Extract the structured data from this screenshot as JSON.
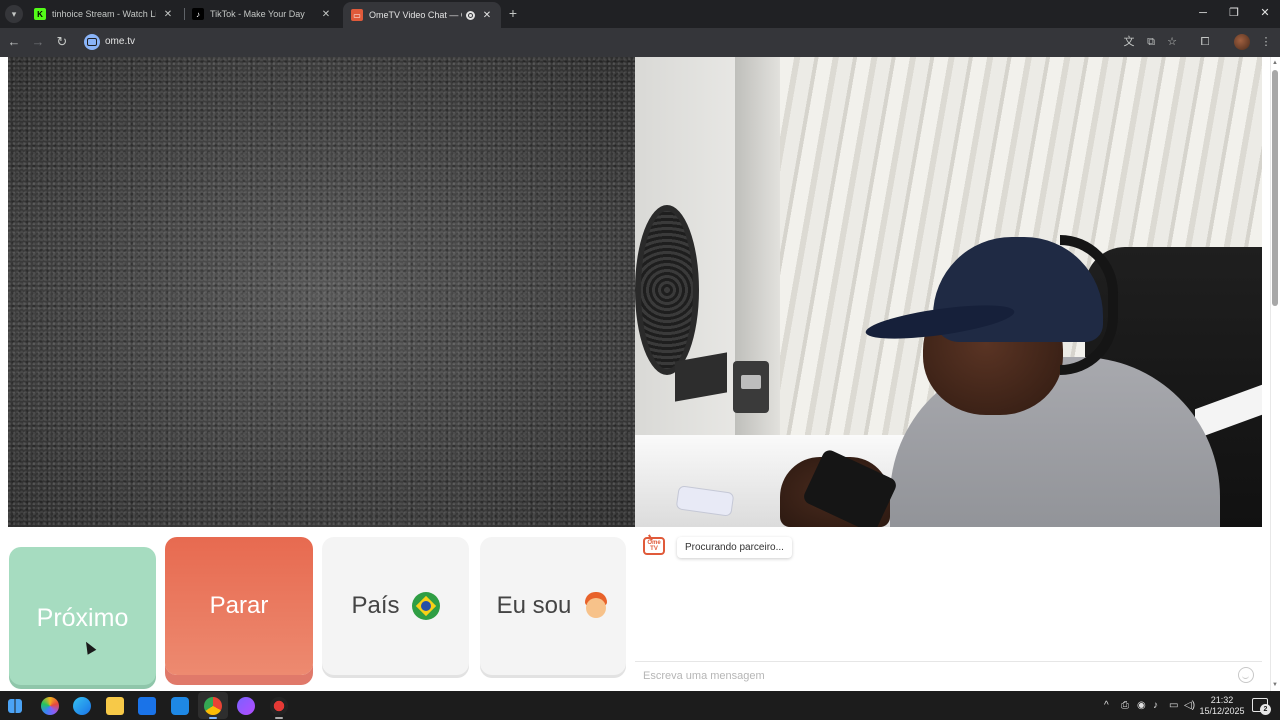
{
  "browser": {
    "tabs": [
      {
        "title": "tinhoice Stream - Watch Live or",
        "favicon": "kick-icon",
        "active": false
      },
      {
        "title": "TikTok - Make Your Day",
        "favicon": "tiktok-icon",
        "active": false
      },
      {
        "title": "OmeTV Video Chat — Ome",
        "favicon": "ometv-icon",
        "active": true
      }
    ],
    "url": "ome.tv"
  },
  "controls": {
    "next_label": "Próximo",
    "stop_label": "Parar",
    "country_label": "País",
    "country_flag": "brazil-flag",
    "gender_label": "Eu sou",
    "gender_icon": "boy-avatar"
  },
  "chat": {
    "logo_text": "Ome TV",
    "status_message": "Procurando parceiro...",
    "input_placeholder": "Escreva uma mensagem"
  },
  "taskbar": {
    "time": "21:32",
    "date": "15/12/2025",
    "notification_count": "2"
  },
  "colors": {
    "next_button": "#a6dcc0",
    "stop_button": "#e76a50",
    "neutral_button": "#f4f4f4"
  }
}
